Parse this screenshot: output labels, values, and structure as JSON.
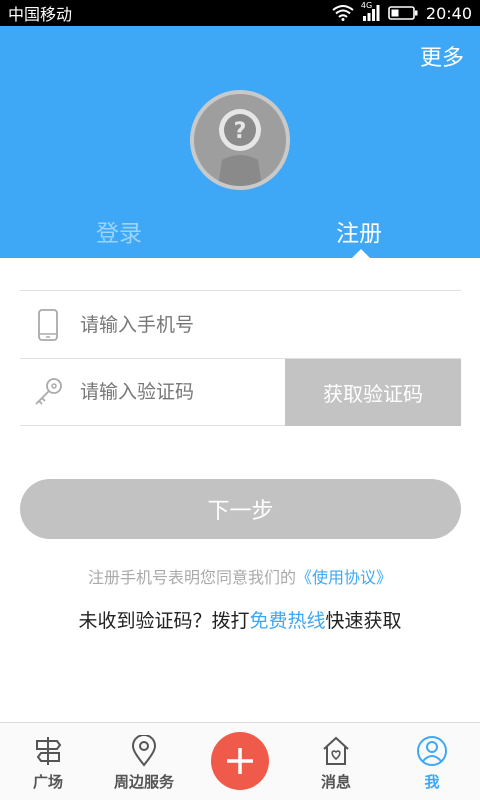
{
  "status_bar": {
    "carrier": "中国移动",
    "network": "4G",
    "time": "20:40"
  },
  "header": {
    "more_label": "更多",
    "tabs": [
      {
        "label": "登录",
        "active": false
      },
      {
        "label": "注册",
        "active": true
      }
    ]
  },
  "form": {
    "phone": {
      "placeholder": "请输入手机号",
      "icon": "phone-icon"
    },
    "code": {
      "placeholder": "请输入验证码",
      "icon": "key-icon"
    },
    "get_code_label": "获取验证码"
  },
  "next_label": "下一步",
  "agreement": {
    "text": "注册手机号表明您同意我们的",
    "link": "《使用协议》"
  },
  "hotline": {
    "prefix": "未收到验证码？拨打",
    "link": "免费热线",
    "suffix": "快速获取"
  },
  "bottom_nav": {
    "items": [
      {
        "label": "广场",
        "icon": "signpost-icon"
      },
      {
        "label": "周边服务",
        "icon": "location-pin-icon"
      },
      {
        "label": "消息",
        "icon": "home-heart-icon"
      },
      {
        "label": "我",
        "icon": "user-icon",
        "active": true
      }
    ],
    "add_icon": "plus-icon"
  },
  "colors": {
    "primary": "#3ea8f7",
    "add_button": "#f05a4b",
    "disabled": "#c2c2c2"
  }
}
